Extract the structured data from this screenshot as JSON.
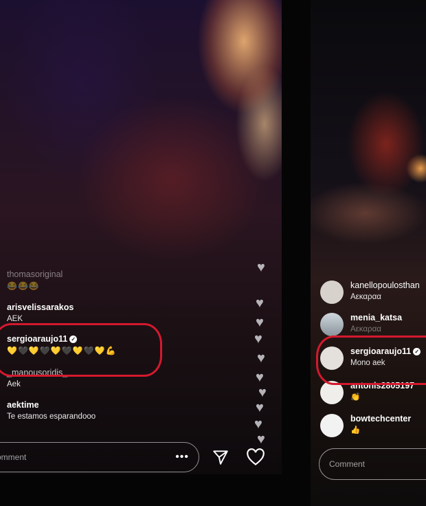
{
  "left": {
    "comments": [
      {
        "user": "thomasoriginal",
        "text": "😂😂😂"
      },
      {
        "user": "arisvelissarakos",
        "text": "AEK"
      },
      {
        "user": "sergioaraujo11",
        "text": "💛🖤💛🖤💛🖤💛🖤💛💪"
      },
      {
        "user": "_manousoridis_",
        "text": "Aek"
      },
      {
        "user": "aektime",
        "text": "Te estamos esparandooo"
      }
    ],
    "comment_placeholder": "omment",
    "more_label": "•••"
  },
  "right": {
    "comments": [
      {
        "user": "kanellopoulosthan",
        "text": "Aεκαραα"
      },
      {
        "user": "menia_katsa",
        "text": "Aεκαραα"
      },
      {
        "user": "sergioaraujo11",
        "text": "Mono aek"
      },
      {
        "user": "antonis2805197",
        "text": "👏"
      },
      {
        "user": "bowtechcenter",
        "text": "👍"
      }
    ],
    "comment_placeholder": "Comment"
  },
  "icons": {
    "verified": "verified-badge-icon",
    "send": "send-icon",
    "heart": "heart-icon"
  },
  "colors": {
    "highlight": "#d4192e"
  }
}
